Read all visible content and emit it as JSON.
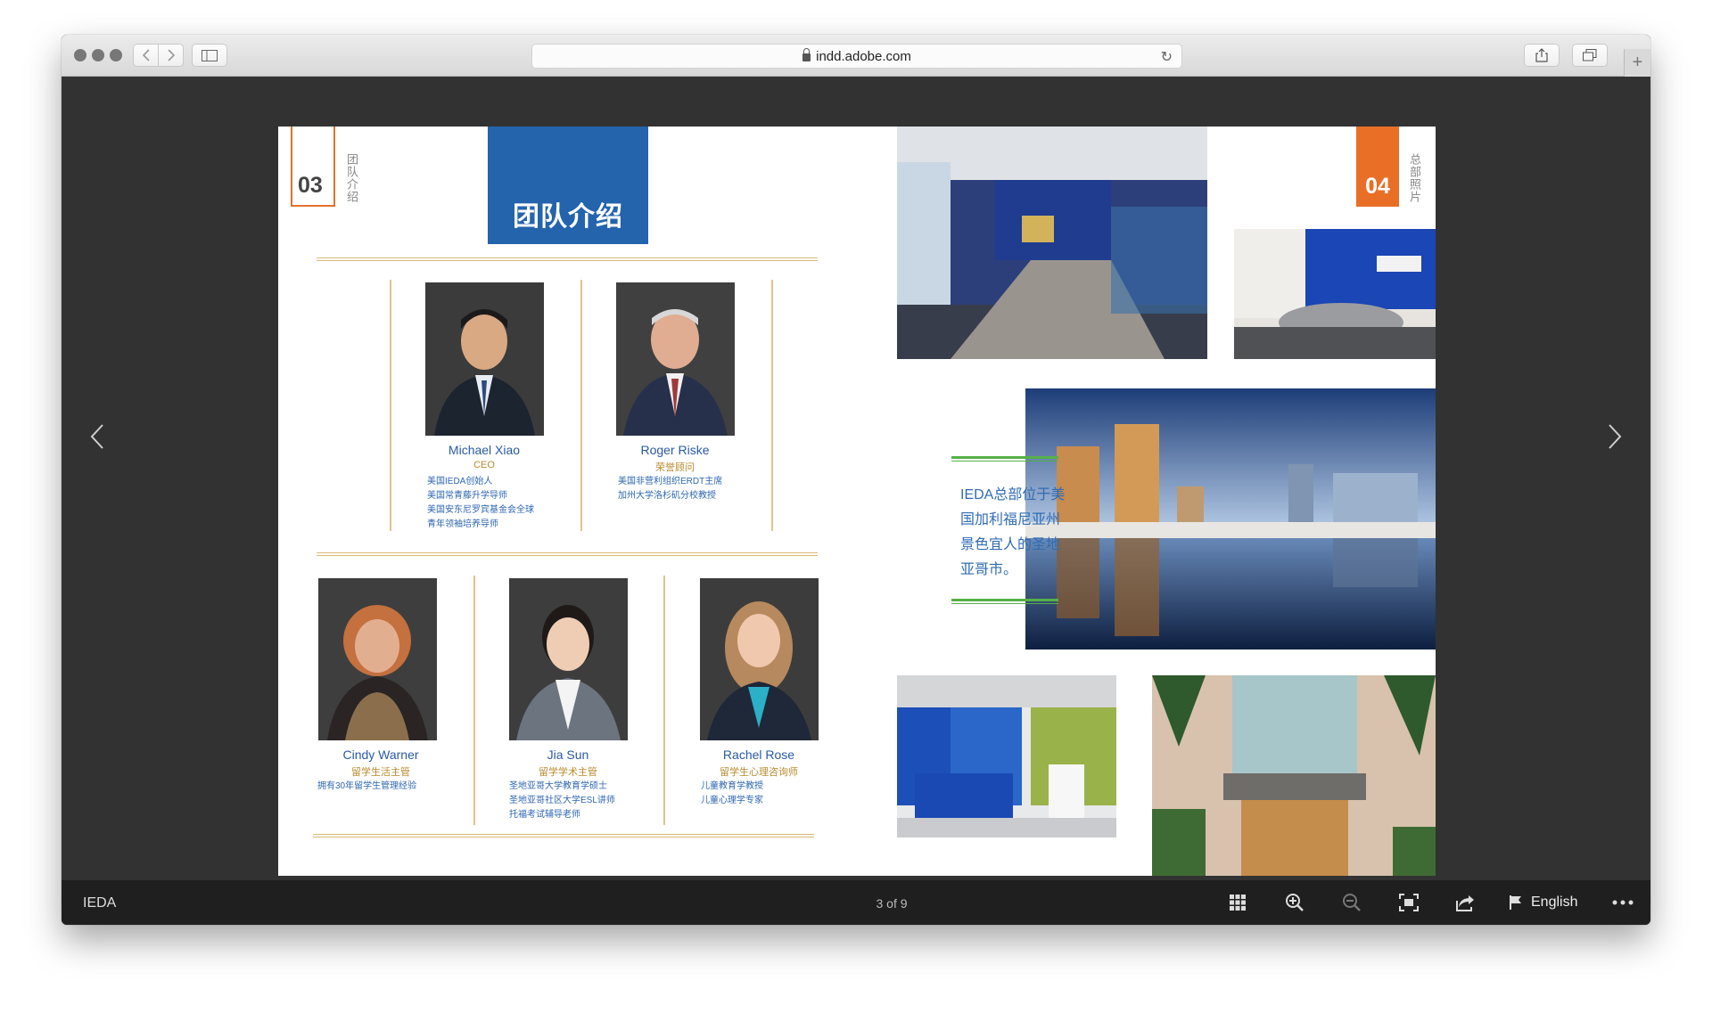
{
  "browser": {
    "url": "indd.adobe.com",
    "back_icon": "chevron-left-icon",
    "forward_icon": "chevron-right-icon"
  },
  "left_page": {
    "section_number": "03",
    "section_label": "团队介绍",
    "title": "团队介绍",
    "members": [
      {
        "name": "Michael Xiao",
        "role": "CEO",
        "desc": [
          "美国IEDA创始人",
          "美国常青藤升学导师",
          "美国安东尼罗宾基金会全球",
          "青年领袖培养导师"
        ]
      },
      {
        "name": "Roger Riske",
        "role": "荣誉顾问",
        "desc": [
          "美国非营利组织ERDT主席",
          "加州大学洛杉矶分校教授"
        ]
      },
      {
        "name": "Cindy Warner",
        "role": "留学生活主管",
        "desc": [
          "拥有30年留学生管理经验"
        ]
      },
      {
        "name": "Jia Sun",
        "role": "留学学术主管",
        "desc": [
          "圣地亚哥大学教育学硕士",
          "圣地亚哥社区大学ESL讲师",
          "托福考试辅导老师"
        ]
      },
      {
        "name": "Rachel Rose",
        "role": "留学生心理咨询师",
        "desc": [
          "儿童教育学教授",
          "儿童心理学专家"
        ]
      }
    ]
  },
  "right_page": {
    "section_number": "04",
    "section_label": "总部照片",
    "hq_text": "IEDA总部位于美国加利福尼亚州景色宜人的圣地亚哥市。"
  },
  "toolbar": {
    "doc_title": "IEDA",
    "page_indicator": "3 of 9",
    "language": "English"
  },
  "colors": {
    "accent_blue": "#2464ad",
    "accent_orange": "#e96f27",
    "accent_green": "#55b048",
    "gold": "#d9b979"
  }
}
